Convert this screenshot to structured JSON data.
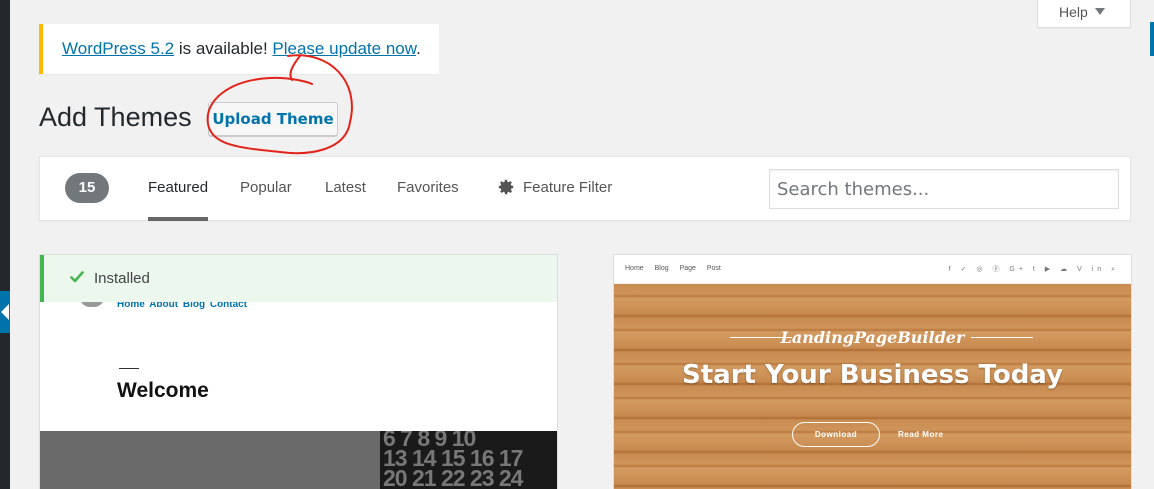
{
  "help_tab": {
    "label": "Help"
  },
  "notice": {
    "version_link": "WordPress 5.2",
    "middle_text": " is available! ",
    "update_link": "Please update now",
    "end_text": "."
  },
  "header": {
    "title": "Add Themes",
    "upload_label": "Upload Theme"
  },
  "filter_bar": {
    "count": "15",
    "tabs": [
      {
        "label": "Featured",
        "active": true
      },
      {
        "label": "Popular"
      },
      {
        "label": "Latest"
      },
      {
        "label": "Favorites"
      }
    ],
    "feature_filter_label": "Feature Filter",
    "search_placeholder": "Search themes..."
  },
  "themes": [
    {
      "installed_label": "Installed",
      "preview": {
        "nav": "Home About Blog Contact",
        "heading": "Welcome",
        "calendar_rows": [
          "6 7 8 9 10",
          "13 14 15 16 17",
          "20 21 22 23 24"
        ]
      }
    },
    {
      "preview": {
        "nav": "Home Blog Page Post",
        "social_icons": "f ✓ ◎ ⓟ G+ t ▶ ☁ V in ⌕",
        "brand": "LandingPageBuilder",
        "headline": "Start Your Business Today",
        "primary_button": "Download",
        "secondary_link": "Read More"
      }
    }
  ],
  "colors": {
    "accent": "#0073aa",
    "notice_warning": "#ffb900",
    "installed_green": "#46b450",
    "annotation_red": "#e2231a"
  }
}
